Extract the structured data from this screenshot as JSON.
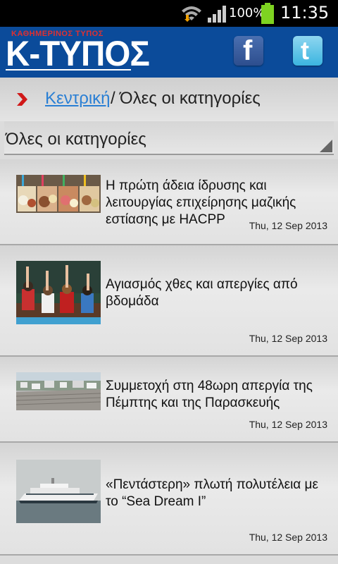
{
  "status_bar": {
    "battery_percent": "100%",
    "time": "11:35",
    "icons": [
      "wifi-icon",
      "signal-icon",
      "battery-icon"
    ]
  },
  "header": {
    "logo_tagline": "ΚΑΘΗΜΕΡΙΝΟΣ ΤΥΠΟΣ",
    "logo_main": "Κ-ΤΥΠΟΣ",
    "facebook_glyph": "f",
    "twitter_glyph": "t",
    "colors": {
      "header_bg": "#0b4b9a",
      "tagline": "#e03030"
    }
  },
  "breadcrumb": {
    "home": "Κεντρική",
    "separator": "/",
    "current": "Όλες οι κατηγορίες"
  },
  "category_select": {
    "selected": "Όλες οι κατηγορίες"
  },
  "articles": [
    {
      "title": "Η πρώτη άδεια ίδρυσης και λειτουργίας επιχείρησης μαζικής εστίασης με HACPP",
      "date": "Thu, 12 Sep 2013",
      "thumb": "ice-cream-display"
    },
    {
      "title": "Αγιασμός χθες και απεργίες από βδομάδα",
      "date": "Thu, 12 Sep 2013",
      "thumb": "classroom-raised-hands"
    },
    {
      "title": "Συμμετοχή στη 48ωρη απεργία της Πέμπτης και της Παρασκευής",
      "date": "Thu, 12 Sep 2013",
      "thumb": "city-rooftops"
    },
    {
      "title": "«Πεντάστερη» πλωτή πολυτέλεια με το “Sea Dream I”",
      "date": "Thu, 12 Sep 2013",
      "thumb": "cruise-yacht"
    }
  ]
}
